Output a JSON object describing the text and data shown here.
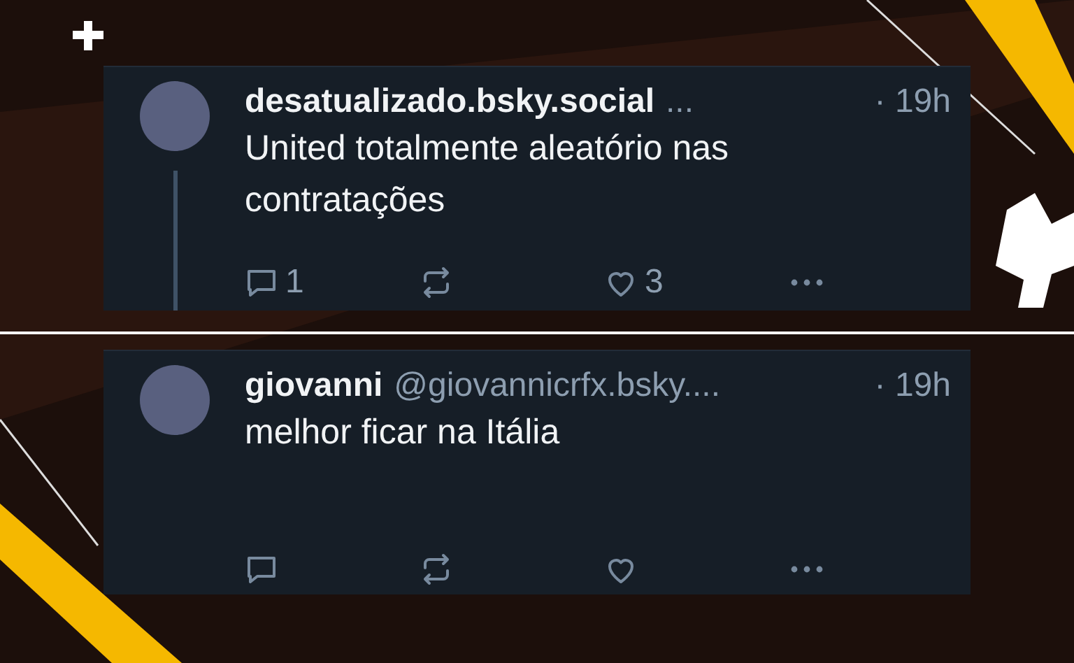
{
  "posts": [
    {
      "display_name": "desatualizado.bsky.social",
      "handle": "...",
      "time": "· 19h",
      "text": "United totalmente aleatório nas contratações",
      "reply_count": "1",
      "like_count": "3",
      "thread_line": true
    },
    {
      "display_name": "giovanni",
      "handle": "@giovannicrfx.bsky....",
      "time": "· 19h",
      "text": "melhor ficar na Itália",
      "thread_line": false
    }
  ]
}
